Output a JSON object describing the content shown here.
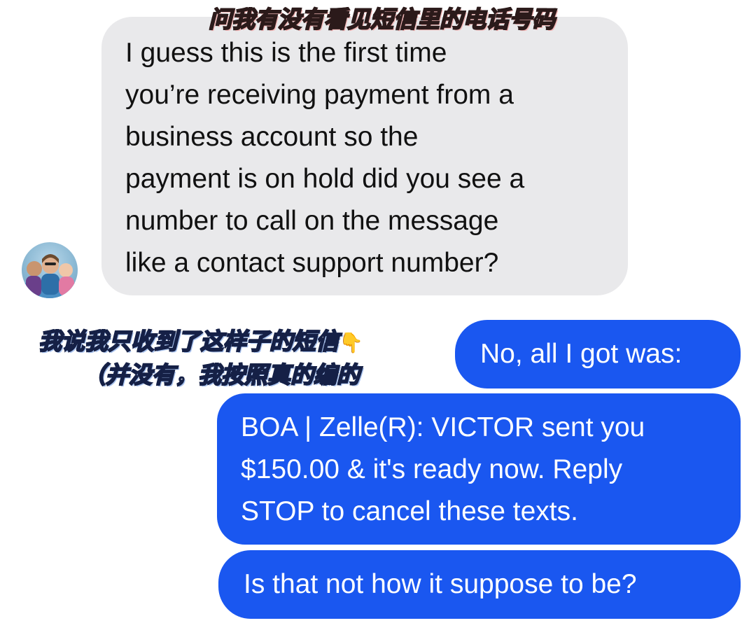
{
  "incoming_message": {
    "text": "I guess this is the first time\nyou’re receiving payment from a\nbusiness account so the\npayment is on hold did you see a\nnumber to call on the message\nlike a contact support number?"
  },
  "outgoing_messages": [
    {
      "text": "No, all I got was:"
    },
    {
      "text": "BOA | Zelle(R): VICTOR sent you\n$150.00 & it's ready now. Reply\nSTOP to cancel these texts."
    },
    {
      "text": "Is that not how it suppose to be?"
    }
  ],
  "annotations": {
    "top": "问我有没有看见短信里的电话号码",
    "middle_line1": "我说我只收到了这样子的短信",
    "middle_line2": "（并没有，我按照真的编的"
  },
  "icons": {
    "avatar": "contact-photo",
    "pointing": "pointing-down-hand"
  },
  "colors": {
    "incoming_bubble": "#e9e9eb",
    "outgoing_bubble": "#1a57f0"
  }
}
